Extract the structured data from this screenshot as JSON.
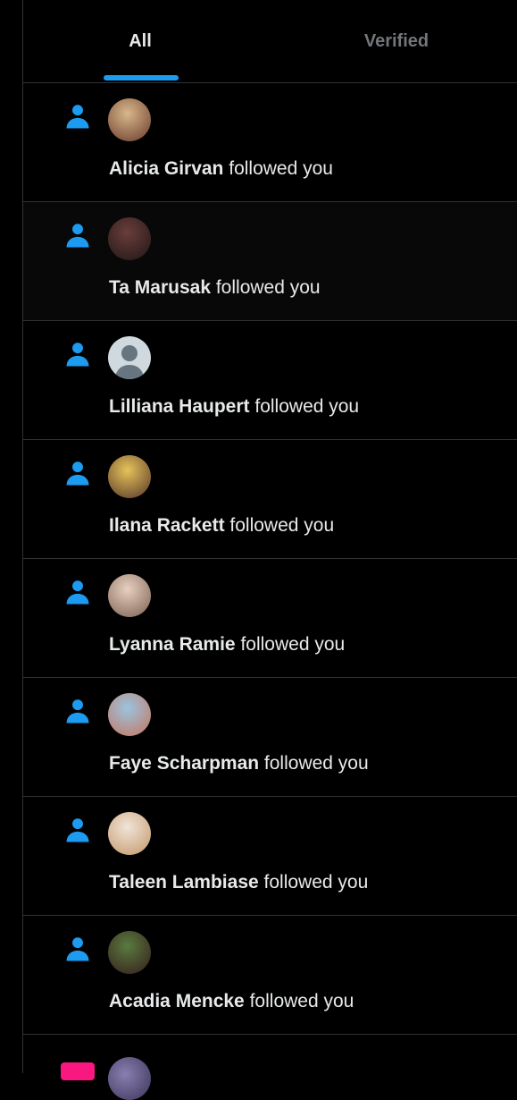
{
  "tabs": {
    "all": "All",
    "verified": "Verified",
    "active": "All"
  },
  "colors": {
    "accent": "#1d9bf0",
    "video": "#f91880"
  },
  "action_text": "followed you",
  "notifications": [
    {
      "name": "Alicia Girvan",
      "avatar_colors": [
        "#d8b88a",
        "#7a4c3a"
      ],
      "icon": "person-icon"
    },
    {
      "name": "Ta Marusak",
      "avatar_colors": [
        "#6a3e3a",
        "#2a1c1c"
      ],
      "icon": "person-icon"
    },
    {
      "name": "Lilliana Haupert",
      "avatar_colors": [
        "#aab8c2",
        "#66757f"
      ],
      "icon": "person-icon",
      "default_avatar": true
    },
    {
      "name": "Ilana Rackett",
      "avatar_colors": [
        "#e6c35a",
        "#6b4a30"
      ],
      "icon": "person-icon"
    },
    {
      "name": "Lyanna Ramie",
      "avatar_colors": [
        "#e8d0c0",
        "#8a7060"
      ],
      "icon": "person-icon"
    },
    {
      "name": "Faye Scharpman",
      "avatar_colors": [
        "#9bc4e0",
        "#c08070"
      ],
      "icon": "person-icon"
    },
    {
      "name": "Taleen Lambiase",
      "avatar_colors": [
        "#f0e4d8",
        "#c9a27a"
      ],
      "icon": "person-icon"
    },
    {
      "name": "Acadia Mencke",
      "avatar_colors": [
        "#5a7a40",
        "#3a2a20"
      ],
      "icon": "person-icon"
    }
  ],
  "partial_row": {
    "icon": "video-icon"
  }
}
